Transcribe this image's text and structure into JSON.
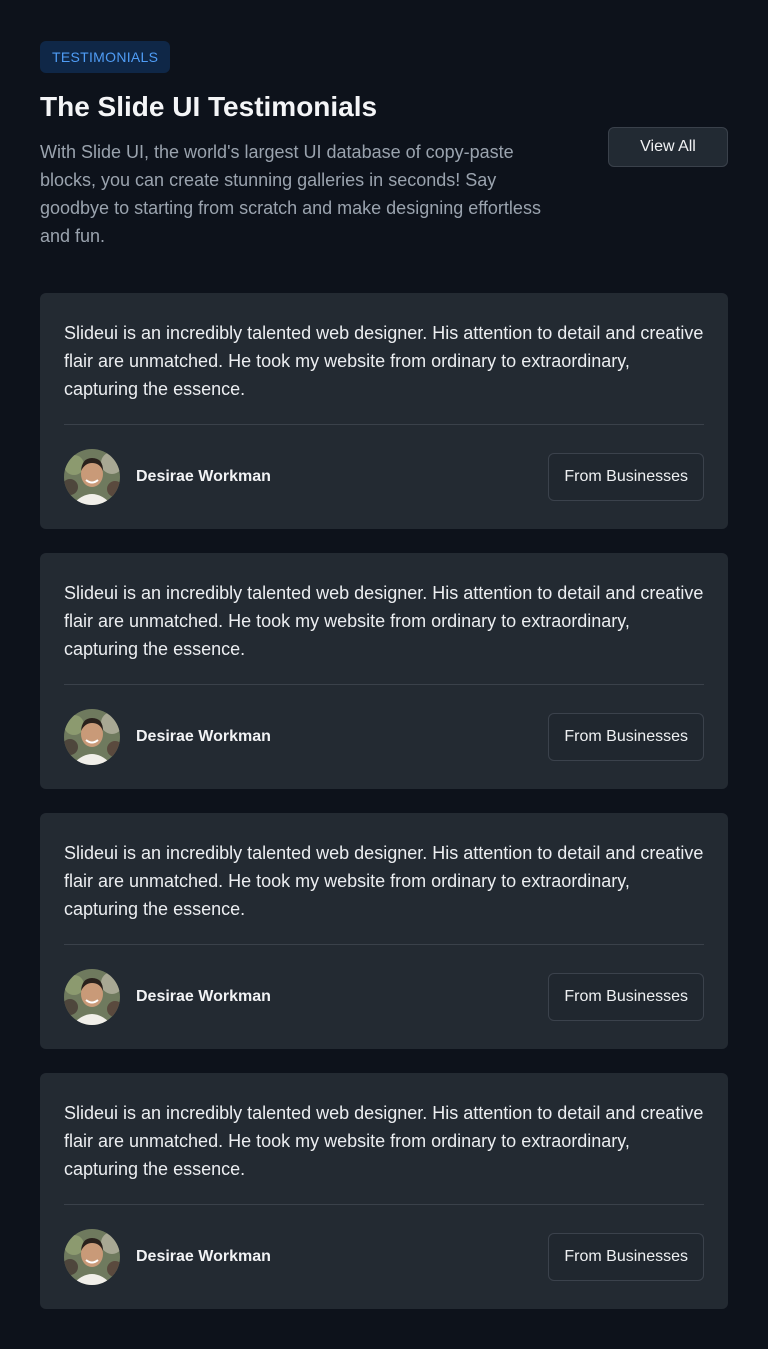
{
  "header": {
    "badge": "TESTIMONIALS",
    "title": "The Slide UI Testimonials",
    "description": "With Slide UI, the world's largest UI database of copy-paste blocks, you can create stunning galleries in seconds! Say goodbye to starting from scratch and make designing effortless and fun.",
    "view_all_label": "View All"
  },
  "colors": {
    "background": "#0d121b",
    "card": "#232a32",
    "badge_bg": "#0f2747",
    "badge_text": "#4f9cf5"
  },
  "testimonials": [
    {
      "quote": "Slideui is an incredibly talented web designer. His attention to detail and creative flair are unmatched. He took my website from ordinary to extraordinary, capturing the essence.",
      "author": "Desirae Workman",
      "avatar_icon": "avatar-photo-icon",
      "source_label": "From Businesses"
    },
    {
      "quote": "Slideui is an incredibly talented web designer. His attention to detail and creative flair are unmatched. He took my website from ordinary to extraordinary, capturing the essence.",
      "author": "Desirae Workman",
      "avatar_icon": "avatar-photo-icon",
      "source_label": "From Businesses"
    },
    {
      "quote": "Slideui is an incredibly talented web designer. His attention to detail and creative flair are unmatched. He took my website from ordinary to extraordinary, capturing the essence.",
      "author": "Desirae Workman",
      "avatar_icon": "avatar-photo-icon",
      "source_label": "From Businesses"
    },
    {
      "quote": "Slideui is an incredibly talented web designer. His attention to detail and creative flair are unmatched. He took my website from ordinary to extraordinary, capturing the essence.",
      "author": "Desirae Workman",
      "avatar_icon": "avatar-photo-icon",
      "source_label": "From Businesses"
    }
  ]
}
